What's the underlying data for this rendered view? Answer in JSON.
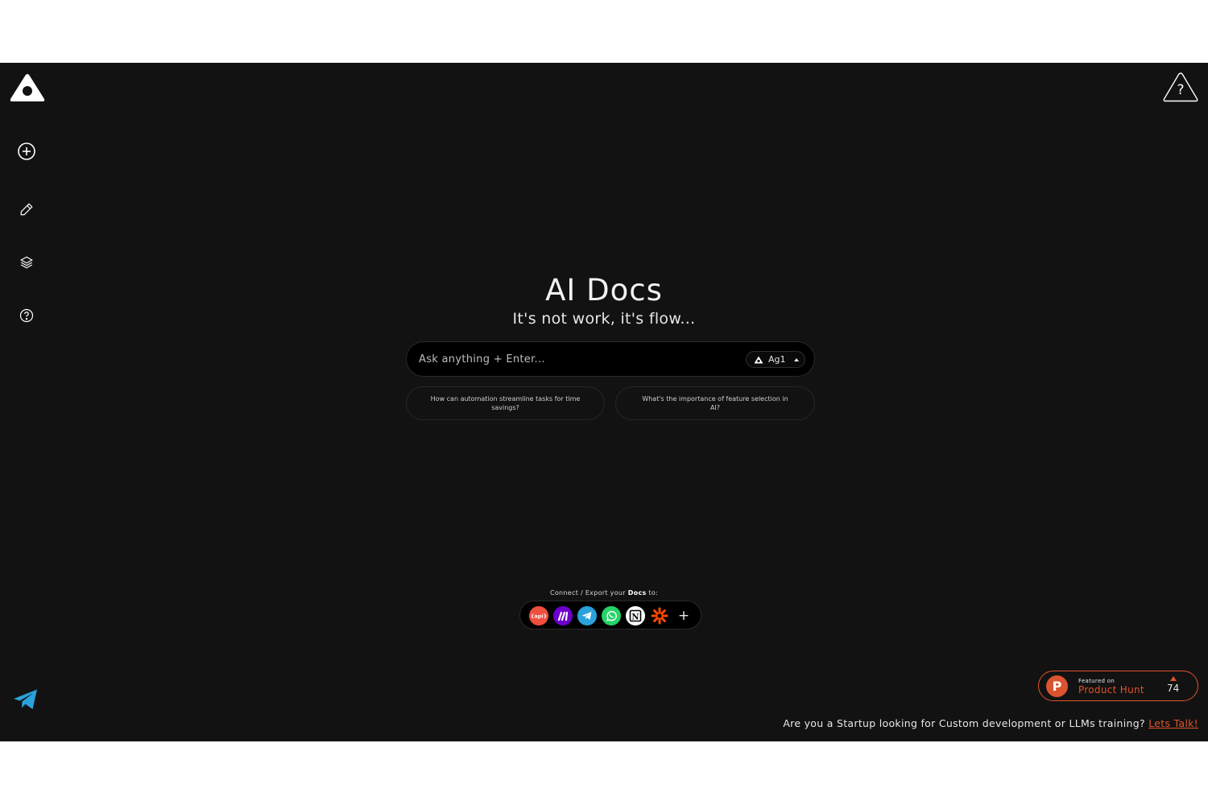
{
  "hero": {
    "title": "AI Docs",
    "subtitle": "It's not work, it's flow..."
  },
  "search": {
    "placeholder": "Ask anything + Enter...",
    "model_label": "Ag1"
  },
  "suggestions": [
    {
      "text": "How can automation streamline tasks for time savings?"
    },
    {
      "text": "What's the importance of feature selection in AI?"
    }
  ],
  "connect": {
    "label_prefix": "Connect / Export your ",
    "label_bold": "Docs",
    "label_suffix": " to:",
    "api_label": "{api}",
    "notion_label": "N",
    "add_label": "+"
  },
  "help": {
    "symbol": "?"
  },
  "product_hunt": {
    "featured_label": "Featured on",
    "name": "Product Hunt",
    "count": "74",
    "logo_letter": "P"
  },
  "footer": {
    "question": "Are you a Startup looking for Custom development or LLMs training? ",
    "cta": "Lets Talk!"
  },
  "colors": {
    "background": "#121212",
    "accent": "#e0542a",
    "telegram": "#2aa1da"
  },
  "icons": {
    "sidebar": [
      "logo-icon",
      "plus-circle-icon",
      "pencil-icon",
      "layers-icon",
      "help-circle-icon"
    ],
    "integrations": [
      "api-icon",
      "make-icon",
      "telegram-icon",
      "whatsapp-icon",
      "notion-icon",
      "zapier-icon",
      "plus-icon"
    ]
  }
}
